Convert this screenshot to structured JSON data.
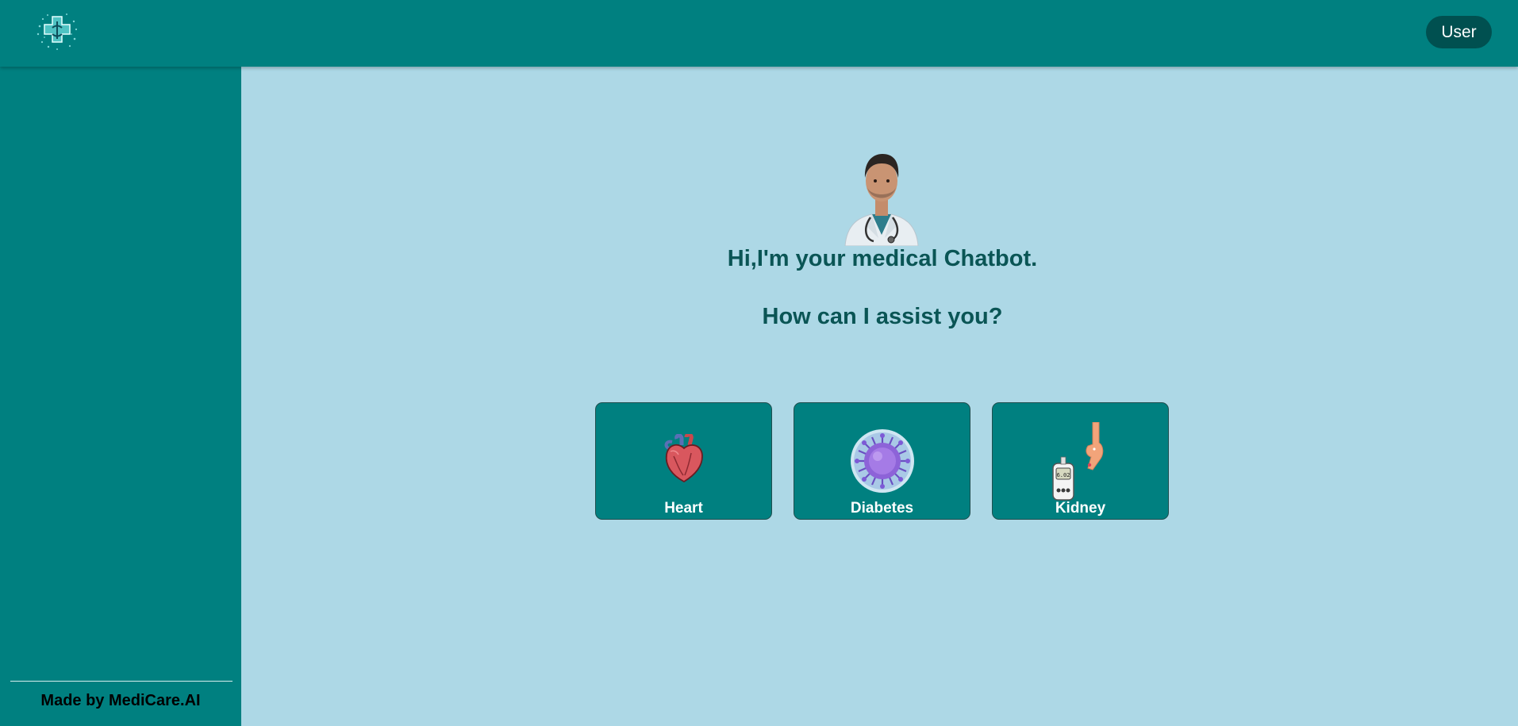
{
  "header": {
    "logo_icon": "medical-cross-logo-icon",
    "user_label": "User"
  },
  "sidebar": {
    "footer_text": "Made by MediCare.AI"
  },
  "main": {
    "avatar_icon": "doctor-avatar-icon",
    "greeting": "Hi,I'm your medical Chatbot.",
    "question": "How can I assist you?",
    "cards": [
      {
        "label": "Heart",
        "icon": "heart-icon"
      },
      {
        "label": "Diabetes",
        "icon": "virus-icon"
      },
      {
        "label": "Kidney",
        "icon": "glucose-meter-icon"
      }
    ]
  },
  "colors": {
    "primary": "#008080",
    "background": "#add8e6",
    "heading_text": "#0a5555",
    "user_button": "#005050"
  }
}
